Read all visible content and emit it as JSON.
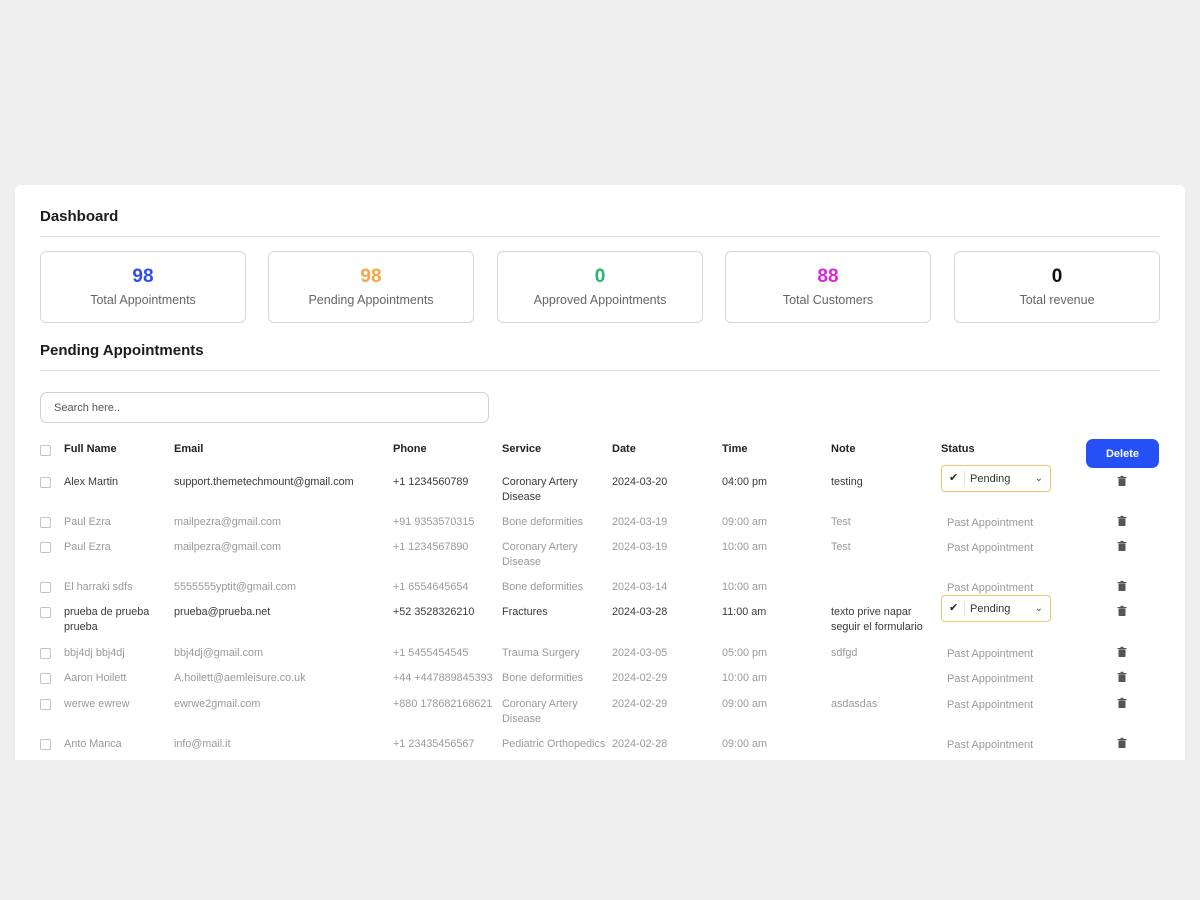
{
  "dashboard": {
    "title": "Dashboard"
  },
  "stats": [
    {
      "value": "98",
      "label": "Total Appointments",
      "color": "#2c4ff2"
    },
    {
      "value": "98",
      "label": "Pending Appointments",
      "color": "#f7a545"
    },
    {
      "value": "0",
      "label": "Approved Appointments",
      "color": "#22b86a"
    },
    {
      "value": "88",
      "label": "Total Customers",
      "color": "#d62bd6"
    },
    {
      "value": "0",
      "label": "Total revenue",
      "color": "#111111"
    }
  ],
  "pending": {
    "title": "Pending Appointments",
    "search_placeholder": "Search here..",
    "delete_label": "Delete",
    "columns": {
      "name": "Full Name",
      "email": "Email",
      "phone": "Phone",
      "service": "Service",
      "date": "Date",
      "time": "Time",
      "note": "Note",
      "status": "Status"
    },
    "rows": [
      {
        "name": "Alex Martin",
        "email": "support.themetechmount@gmail.com",
        "phone": "+1 1234560789",
        "service": "Coronary Artery Disease",
        "date": "2024-03-20",
        "time": "04:00 pm",
        "note": "testing",
        "status": "Pending",
        "type": "active"
      },
      {
        "name": "Paul Ezra",
        "email": "mailpezra@gmail.com",
        "phone": "+91 9353570315",
        "service": "Bone deformities",
        "date": "2024-03-19",
        "time": "09:00 am",
        "note": "Test",
        "status": "Past Appointment",
        "type": "past"
      },
      {
        "name": "Paul Ezra",
        "email": "mailpezra@gmail.com",
        "phone": "+1 1234567890",
        "service": "Coronary Artery Disease",
        "date": "2024-03-19",
        "time": "10:00 am",
        "note": "Test",
        "status": "Past Appointment",
        "type": "past"
      },
      {
        "name": "El harraki sdfs",
        "email": "5555555yptit@gmail.com",
        "phone": "+1 6554645654",
        "service": "Bone deformities",
        "date": "2024-03-14",
        "time": "10:00 am",
        "note": "",
        "status": "Past Appointment",
        "type": "past"
      },
      {
        "name": "prueba de prueba prueba",
        "email": "prueba@prueba.net",
        "phone": "+52 3528326210",
        "service": "Fractures",
        "date": "2024-03-28",
        "time": "11:00 am",
        "note": "texto prive napar seguir el formulario",
        "status": "Pending",
        "type": "active"
      },
      {
        "name": "bbj4dj bbj4dj",
        "email": "bbj4dj@gmail.com",
        "phone": "+1 5455454545",
        "service": "Trauma Surgery",
        "date": "2024-03-05",
        "time": "05:00 pm",
        "note": "sdfgd",
        "status": "Past Appointment",
        "type": "past"
      },
      {
        "name": "Aaron Hoilett",
        "email": "A.hoilett@aemleisure.co.uk",
        "phone": "+44 +447889845393",
        "service": "Bone deformities",
        "date": "2024-02-29",
        "time": "10:00 am",
        "note": "",
        "status": "Past Appointment",
        "type": "past"
      },
      {
        "name": "werwe ewrew",
        "email": "ewrwe2gmail.com",
        "phone": "+880 178682168621",
        "service": "Coronary Artery Disease",
        "date": "2024-02-29",
        "time": "09:00 am",
        "note": "asdasdas",
        "status": "Past Appointment",
        "type": "past"
      },
      {
        "name": "Anto Manca",
        "email": "info@mail.it",
        "phone": "+1 23435456567",
        "service": "Pediatric Orthopedics",
        "date": "2024-02-28",
        "time": "09:00 am",
        "note": "",
        "status": "Past Appointment",
        "type": "past"
      }
    ]
  },
  "icons": {
    "check": "check-icon",
    "chevron": "chevron-down-icon",
    "trash": "trash-icon"
  }
}
